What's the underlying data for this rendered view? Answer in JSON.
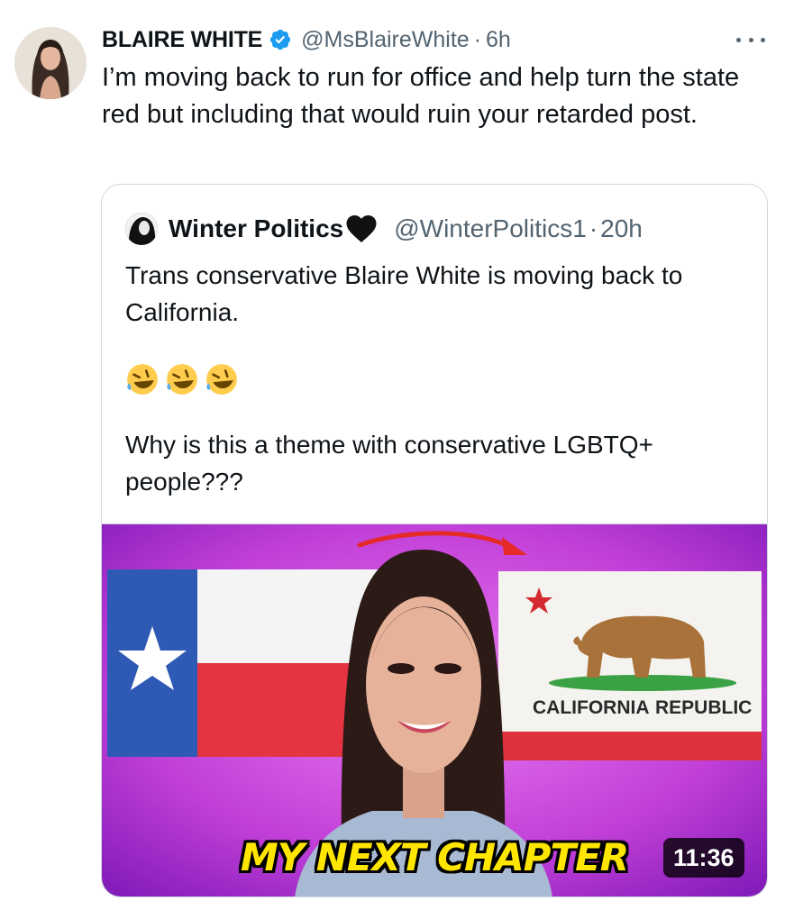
{
  "tweet": {
    "display_name": "BLAIRE WHITE",
    "handle": "@MsBlaireWhite",
    "separator": "·",
    "time": "6h",
    "text": "I’m moving back to run for office and help turn the state red but including that would ruin your retarded post.",
    "verified": true,
    "accent_color": "#1d9bf0"
  },
  "quoted_tweet": {
    "display_name": "Winter Politics",
    "name_emoji": "black-heart",
    "handle": "@WinterPolitics1",
    "separator": "·",
    "time": "20h",
    "text_line1": "Trans conservative Blaire White is moving back to California.",
    "emojis": [
      "rolling-on-floor-laughing",
      "rolling-on-floor-laughing",
      "rolling-on-floor-laughing"
    ],
    "text_line2": "Why is this a theme with conservative LGBTQ+ people???"
  },
  "video": {
    "title_overlay": "MY NEXT CHAPTER",
    "duration": "11:36",
    "flag_text_left": "CALIFORNIA",
    "flag_text_right": "REPUBLIC"
  }
}
